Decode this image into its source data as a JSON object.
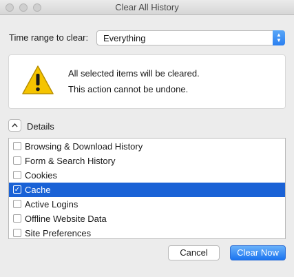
{
  "window": {
    "title": "Clear All History"
  },
  "time_range": {
    "label": "Time range to clear:",
    "selected": "Everything"
  },
  "warning": {
    "line1": "All selected items will be cleared.",
    "line2": "This action cannot be undone."
  },
  "details": {
    "label": "Details"
  },
  "items": [
    {
      "label": "Browsing & Download History",
      "checked": false
    },
    {
      "label": "Form & Search History",
      "checked": false
    },
    {
      "label": "Cookies",
      "checked": false
    },
    {
      "label": "Cache",
      "checked": true
    },
    {
      "label": "Active Logins",
      "checked": false
    },
    {
      "label": "Offline Website Data",
      "checked": false
    },
    {
      "label": "Site Preferences",
      "checked": false
    }
  ],
  "buttons": {
    "cancel": "Cancel",
    "clear": "Clear Now"
  },
  "icons": {
    "close": "close-icon",
    "minimize": "minimize-icon",
    "zoom": "zoom-icon",
    "warning": "warning-icon",
    "select_arrows": "up-down-arrows-icon",
    "disclosure": "chevron-up-icon",
    "checkmark": "checkmark-icon"
  },
  "colors": {
    "selection": "#1a62d6",
    "primary_button": "#1b74f0",
    "warning_fill": "#f5c400"
  }
}
